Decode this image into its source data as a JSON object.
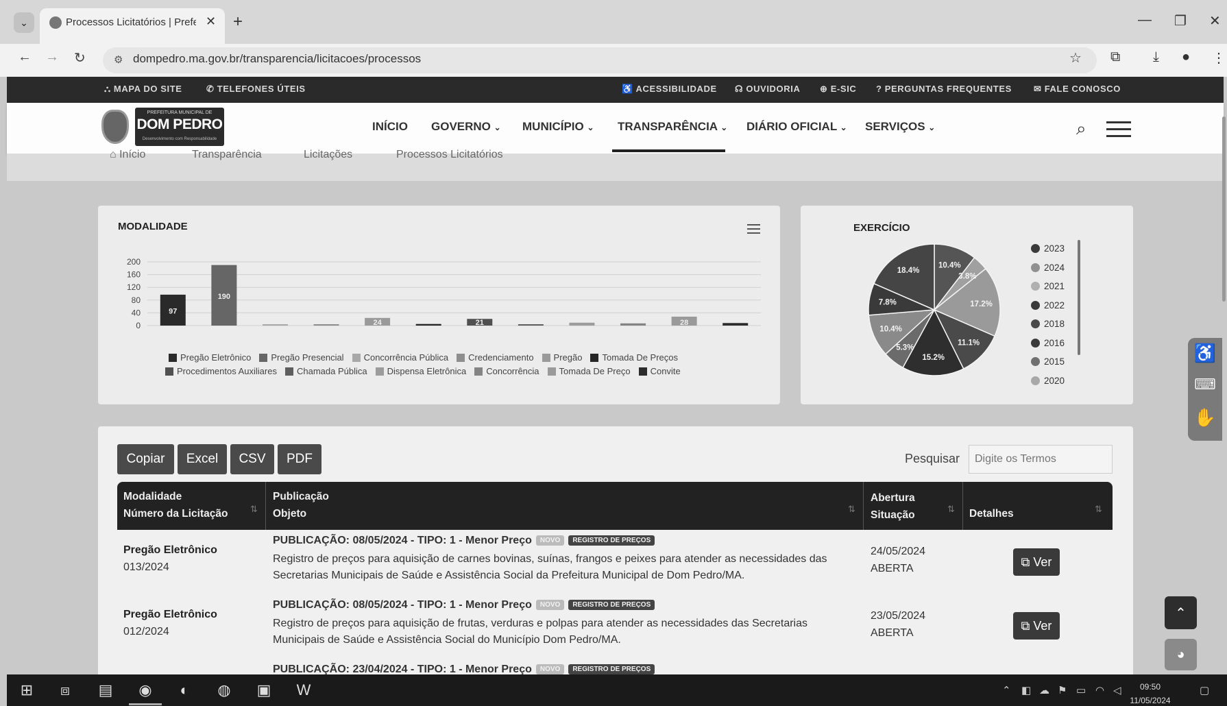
{
  "browser": {
    "tab_title": "Processos Licitatórios | Prefeitu",
    "url": "dompedro.ma.gov.br/transparencia/licitacoes/processos"
  },
  "topbar": {
    "left": [
      "MAPA DO SITE",
      "TELEFONES ÚTEIS"
    ],
    "right": [
      "ACESSIBILIDADE",
      "OUVIDORIA",
      "E-SIC",
      "PERGUNTAS FREQUENTES",
      "FALE CONOSCO"
    ]
  },
  "logo": {
    "small": "PREFEITURA MUNICIPAL DE",
    "main": "DOM PEDRO",
    "sub": "Desenvolvimento com Responsabilidade"
  },
  "menu": [
    "INÍCIO",
    "GOVERNO",
    "MUNICÍPIO",
    "TRANSPARÊNCIA",
    "DIÁRIO OFICIAL",
    "SERVIÇOS"
  ],
  "breadcrumb": [
    "Início",
    "Transparência",
    "Licitações",
    "Processos Licitatórios"
  ],
  "modalidade": {
    "title": "MODALIDADE"
  },
  "exercicio": {
    "title": "EXERCÍCIO"
  },
  "chart_data": [
    {
      "type": "bar",
      "title": "MODALIDADE",
      "ylim": [
        0,
        200
      ],
      "yticks": [
        0,
        40,
        80,
        120,
        160,
        200
      ],
      "grid": true,
      "legend_position": "bottom",
      "categories": [
        "Pregão Eletrônico",
        "Pregão Presencial",
        "Concorrência Pública",
        "Credenciamento",
        "Pregão",
        "Tomada De Preços",
        "Procedimentos Auxiliares",
        "Chamada Pública",
        "Dispensa Eletrônica",
        "Concorrência",
        "Tomada De Preço",
        "Convite"
      ],
      "values": [
        97,
        190,
        2,
        1,
        24,
        5,
        21,
        3,
        9,
        7,
        28,
        8
      ],
      "colors": [
        "#2a2a2a",
        "#666666",
        "#a8a8a8",
        "#8e8e8e",
        "#9a9a9a",
        "#262626",
        "#505050",
        "#5e5e5e",
        "#9c9c9c",
        "#848484",
        "#9a9a9a",
        "#2c2c2c"
      ],
      "data_labels": [
        "97",
        "190",
        "",
        "",
        "24",
        "",
        "21",
        "",
        "",
        "",
        "28",
        ""
      ]
    },
    {
      "type": "pie",
      "title": "EXERCÍCIO",
      "legend_position": "right",
      "labels": [
        "2023",
        "2024",
        "2021",
        "2022",
        "2018",
        "2016",
        "2015",
        "2020"
      ],
      "values": [
        10.4,
        3.8,
        17.2,
        11.1,
        15.2,
        5.3,
        10.4,
        7.8,
        18.4
      ],
      "slice_labels": [
        "10.4%",
        "3.8%",
        "17.2%",
        "11.1%",
        "15.2%",
        "5.3%",
        "10.4%",
        "7.8%",
        "18.4%"
      ],
      "slice_colors": [
        "#555555",
        "#a0a0a0",
        "#9a9a9a",
        "#4a4a4a",
        "#2e2e2e",
        "#6b6b6b",
        "#8a8a8a",
        "#3a3a3a",
        "#454545"
      ],
      "legend_colors": [
        "#3a3a3a",
        "#909090",
        "#b0b0b0",
        "#3a3a3a",
        "#4a4a4a",
        "#3a3a3a",
        "#707070",
        "#a8a8a8"
      ]
    }
  ],
  "table": {
    "buttons": [
      "Copiar",
      "Excel",
      "CSV",
      "PDF"
    ],
    "search_label": "Pesquisar",
    "search_placeholder": "Digite os Termos",
    "headers": {
      "col1_a": "Modalidade",
      "col1_b": "Número da Licitação",
      "col2_a": "Publicação",
      "col2_b": "Objeto",
      "col3_a": "Abertura",
      "col3_b": "Situação",
      "col4": "Detalhes"
    },
    "badge_novo": "NOVO",
    "badge_registro": "REGISTRO DE PREÇOS",
    "ver_label": "Ver",
    "rows": [
      {
        "modalidade": "Pregão Eletrônico",
        "numero": "013/2024",
        "publicacao": "PUBLICAÇÃO: 08/05/2024 - TIPO: 1 - Menor Preço",
        "objeto": "Registro de preços para aquisição de carnes bovinas, suínas, frangos e peixes para atender as necessidades das Secretarias Municipais de Saúde e Assistência Social da Prefeitura Municipal de Dom Pedro/MA.",
        "abertura": "24/05/2024",
        "situacao": "ABERTA"
      },
      {
        "modalidade": "Pregão Eletrônico",
        "numero": "012/2024",
        "publicacao": "PUBLICAÇÃO: 08/05/2024 - TIPO: 1 - Menor Preço",
        "objeto": "Registro de preços para aquisição de frutas, verduras e polpas para atender as necessidades das Secretarias Municipais de Saúde e Assistência Social do Município Dom Pedro/MA.",
        "abertura": "23/05/2024",
        "situacao": "ABERTA"
      },
      {
        "publicacao": "PUBLICAÇÃO: 23/04/2024 - TIPO: 1 - Menor Preço"
      }
    ]
  },
  "taskbar": {
    "time": "09:50",
    "date": "11/05/2024"
  }
}
